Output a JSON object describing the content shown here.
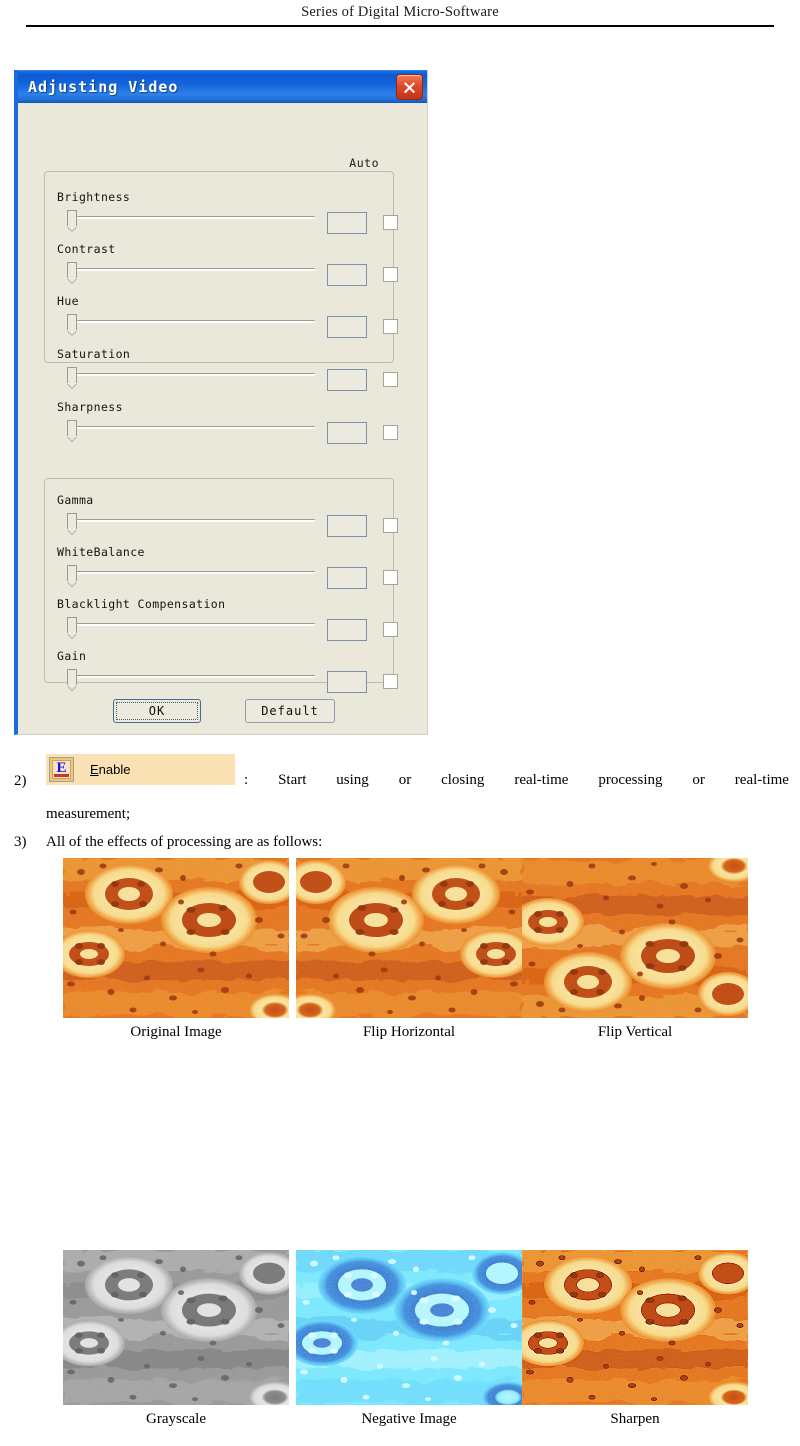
{
  "header": {
    "title": "Series of Digital Micro-Software"
  },
  "dialog": {
    "title": "Adjusting Video",
    "close_icon": "close-icon",
    "auto_column_label": "Auto",
    "groups": [
      {
        "name": "image-controls",
        "sliders": [
          {
            "label": "Brightness",
            "value": "",
            "auto": false
          },
          {
            "label": "Contrast",
            "value": "",
            "auto": false
          },
          {
            "label": "Hue",
            "value": "",
            "auto": false
          },
          {
            "label": "Saturation",
            "value": "",
            "auto": false
          },
          {
            "label": "Sharpness",
            "value": "",
            "auto": false
          }
        ]
      },
      {
        "name": "camera-controls",
        "sliders": [
          {
            "label": "Gamma",
            "value": "",
            "auto": false
          },
          {
            "label": "WhiteBalance",
            "value": "",
            "auto": false
          },
          {
            "label": "Blacklight Compensation",
            "value": "",
            "auto": false
          },
          {
            "label": "Gain",
            "value": "",
            "auto": false
          }
        ]
      }
    ],
    "buttons": {
      "ok": "OK",
      "default": "Default"
    }
  },
  "document": {
    "item2": {
      "number": "2)",
      "chip_label": "Enable",
      "chip_accel": "E",
      "chip_rest": "nable",
      "chip_icon": "enable-icon",
      "description_line1": [
        ":",
        "Start",
        "using",
        "or",
        "closing",
        "real-time",
        "processing",
        "or",
        "real-time"
      ],
      "description_line2": "measurement;"
    },
    "item3": {
      "number": "3)",
      "text": "All of the effects of processing are as follows:"
    }
  },
  "gallery": {
    "items": [
      {
        "caption": "Original Image",
        "effect": "original"
      },
      {
        "caption": "Flip Horizontal",
        "effect": "flip-h"
      },
      {
        "caption": "Flip Vertical",
        "effect": "flip-v"
      },
      {
        "caption": "Grayscale",
        "effect": "grayscale"
      },
      {
        "caption": "Negative Image",
        "effect": "negative"
      },
      {
        "caption": "Sharpen",
        "effect": "sharpen"
      }
    ]
  },
  "colors": {
    "titlebar_blue": "#1464d9",
    "dialog_face": "#e9e8da",
    "close_red": "#e04a29",
    "highlight_peach": "#fbe2b4",
    "textbox_border": "#7d93aa",
    "micro_orange": "#e8741c",
    "micro_yellow": "#fbe08a",
    "micro_deep": "#b03a10",
    "negative_blue": "#1b82e6"
  }
}
